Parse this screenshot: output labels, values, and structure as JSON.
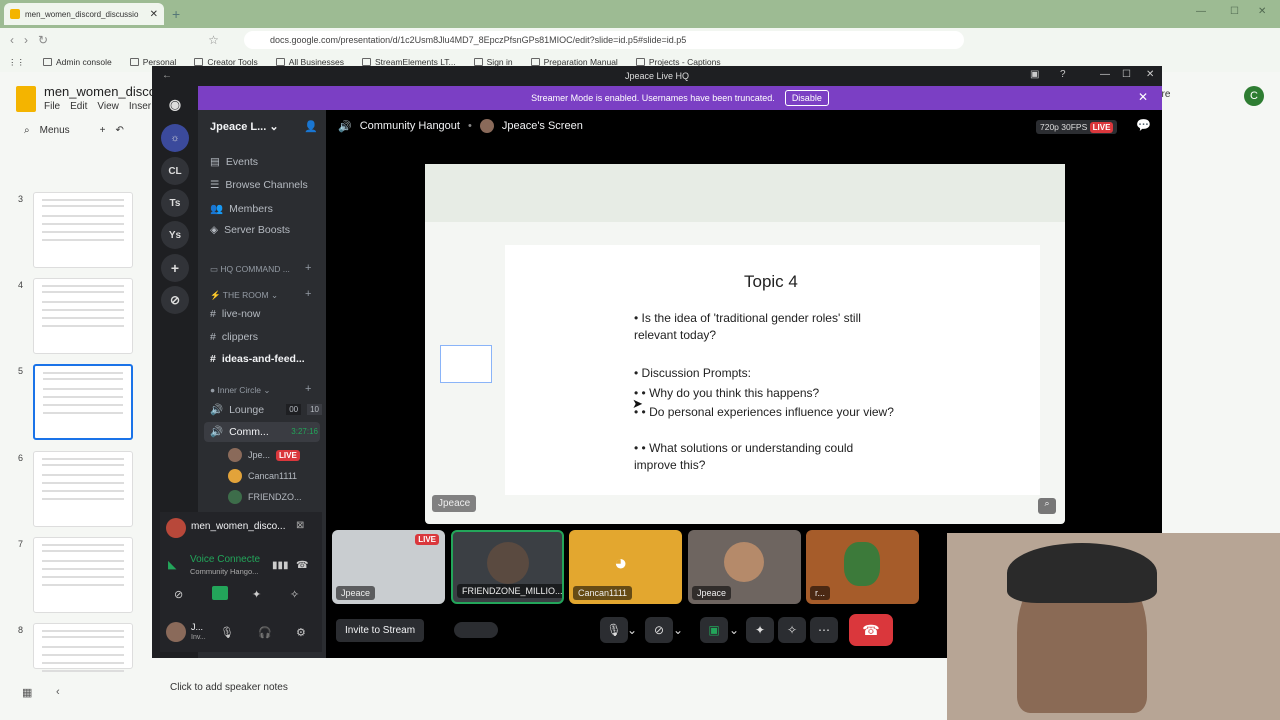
{
  "browser": {
    "tab_title": "men_women_discord_discussio",
    "url": "docs.google.com/presentation/d/1c2Usm8Jlu4MD7_8EpczPfsnGPs81MIOC/edit?slide=id.p5#slide=id.p5",
    "bookmarks": [
      "Admin console",
      "Personal",
      "Creator Tools",
      "All Businesses",
      "StreamElements LT...",
      "Sign in",
      "Preparation Manual",
      "Projects - Captions"
    ]
  },
  "slides": {
    "doc_title": "men_women_discor",
    "menus": [
      "File",
      "Edit",
      "View",
      "Inser"
    ],
    "menus_label": "Menus",
    "share_fragment": "are",
    "avatar_letter": "C",
    "thumbnails": [
      {
        "num": "3",
        "title": "Topic 2"
      },
      {
        "num": "4",
        "title": "Topic 3"
      },
      {
        "num": "5",
        "title": "Topic 4"
      },
      {
        "num": "6",
        "title": "Topic 5"
      },
      {
        "num": "7",
        "title": "Topic 6"
      },
      {
        "num": "8",
        "title": "Topic 7"
      }
    ],
    "speaker_notes": "Click to add speaker notes"
  },
  "discord": {
    "window_title": "Jpeace Live HQ",
    "banner_text": "Streamer Mode is enabled. Usernames have been truncated.",
    "banner_button": "Disable",
    "guilds": [
      "CL",
      "Ts",
      "Ys"
    ],
    "server_name": "Jpeace L...",
    "menu_items": [
      "Events",
      "Browse Channels",
      "Members",
      "Server Boosts"
    ],
    "category1": "HQ COMMAND ...",
    "category2": "THE ROOM",
    "text_channels": [
      "live-now",
      "clippers",
      "ideas-and-feed..."
    ],
    "category3": "Inner Circle",
    "voice_channels": [
      {
        "name": "Lounge",
        "count_a": "00",
        "count_b": "10"
      },
      {
        "name": "Comm...",
        "timer": "3:27:16"
      }
    ],
    "voice_members": [
      "Jpe...",
      "Cancan1111",
      "FRIENDZO..."
    ],
    "live_label": "LIVE",
    "active_stream_name": "men_women_disco...",
    "voice_connected": "Voice Connecte",
    "voice_channel_sub": "Community Hango...",
    "user_name": "J...",
    "user_status": "Inv...",
    "stage_channel": "Community Hangout",
    "stage_stream": "Jpeace's Screen",
    "quality": "720p 30FPS",
    "invite_button": "Invite to Stream",
    "tiles": [
      {
        "label": "Jpeace",
        "live": "LIVE"
      },
      {
        "label": "FRIENDZONE_MILLIO..."
      },
      {
        "label": "Cancan1111"
      },
      {
        "label": "Jpeace"
      },
      {
        "label": "r..."
      }
    ],
    "screen_label": "Jpeace"
  },
  "shared_slide": {
    "title": "Topic 4",
    "bullets": [
      "Is the idea of 'traditional gender roles' still relevant today?",
      "Discussion Prompts:",
      "• Why do you think this happens?",
      "• Do personal experiences influence your view?",
      "• What solutions or understanding could improve this?"
    ]
  }
}
